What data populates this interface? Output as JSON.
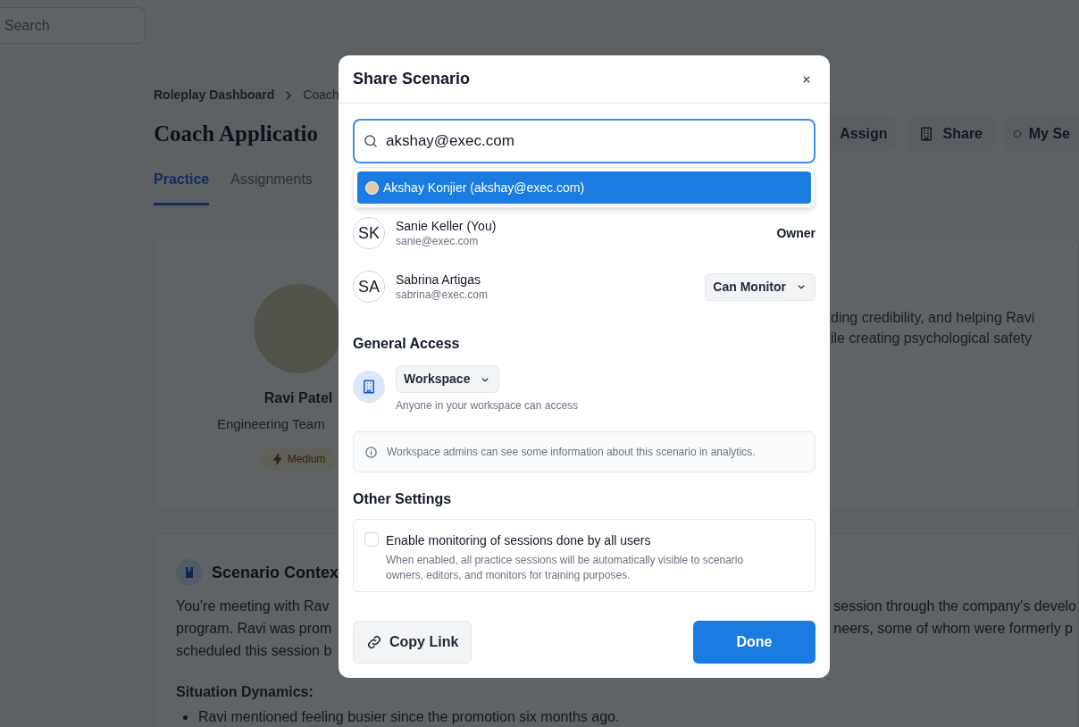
{
  "top_bar": {
    "search": {
      "placeholder": "Search"
    }
  },
  "breadcrumb": [
    "Roleplay Dashboard",
    "Coach"
  ],
  "page_title": "Coach Applicatio",
  "actions": [
    {
      "kind": "plain",
      "label": "Assign"
    },
    {
      "kind": "building",
      "label": "Share"
    },
    {
      "kind": "circle",
      "label": "My Se"
    }
  ],
  "tabs": [
    {
      "label": "Practice",
      "selected": true
    },
    {
      "label": "Assignments",
      "selected": false
    }
  ],
  "persona_card": {
    "name": "Ravi Patel",
    "team": "Engineering Team",
    "difficulty": "Medium",
    "description_fragments": [
      "ding credibility, and helping Ravi",
      "ile creating psychological safety"
    ]
  },
  "scenario_card": {
    "title": "Scenario Contex",
    "paragraph_left": [
      "You're meeting with Rav",
      "program. Ravi was prom",
      "scheduled this session b"
    ],
    "paragraph_right": [
      "session through the company's develo",
      "neers, some of whom were formerly p"
    ],
    "section_heading": "Situation Dynamics:",
    "bullets": [
      "Ravi mentioned feeling busier since the promotion six months ago."
    ]
  },
  "dialog": {
    "title": "Share Scenario",
    "search": {
      "value": "akshay@exec.com"
    },
    "suggestions": [
      {
        "label": "Akshay Konjier (akshay@exec.com)",
        "selected": true
      }
    ],
    "people": [
      {
        "initials": "SK",
        "name": "Sanie Keller (You)",
        "email": "sanie@exec.com",
        "kind": "text",
        "role": "Owner"
      },
      {
        "initials": "SA",
        "name": "Sabrina Artigas",
        "email": "sabrina@exec.com",
        "kind": "dropdown",
        "role": "Can Monitor"
      }
    ],
    "general_access": {
      "heading": "General Access",
      "option": "Workspace",
      "hint": "Anyone in your workspace can access"
    },
    "info_note": "Workspace admins can see some information about this scenario in analytics.",
    "other_settings": {
      "heading": "Other Settings",
      "setting": {
        "label": "Enable monitoring of sessions done by all users",
        "description": "When enabled, all practice sessions will be automatically visible to scenario owners, editors, and monitors for training purposes.",
        "checked": false
      }
    },
    "copy_link": "Copy Link",
    "done": "Done"
  }
}
